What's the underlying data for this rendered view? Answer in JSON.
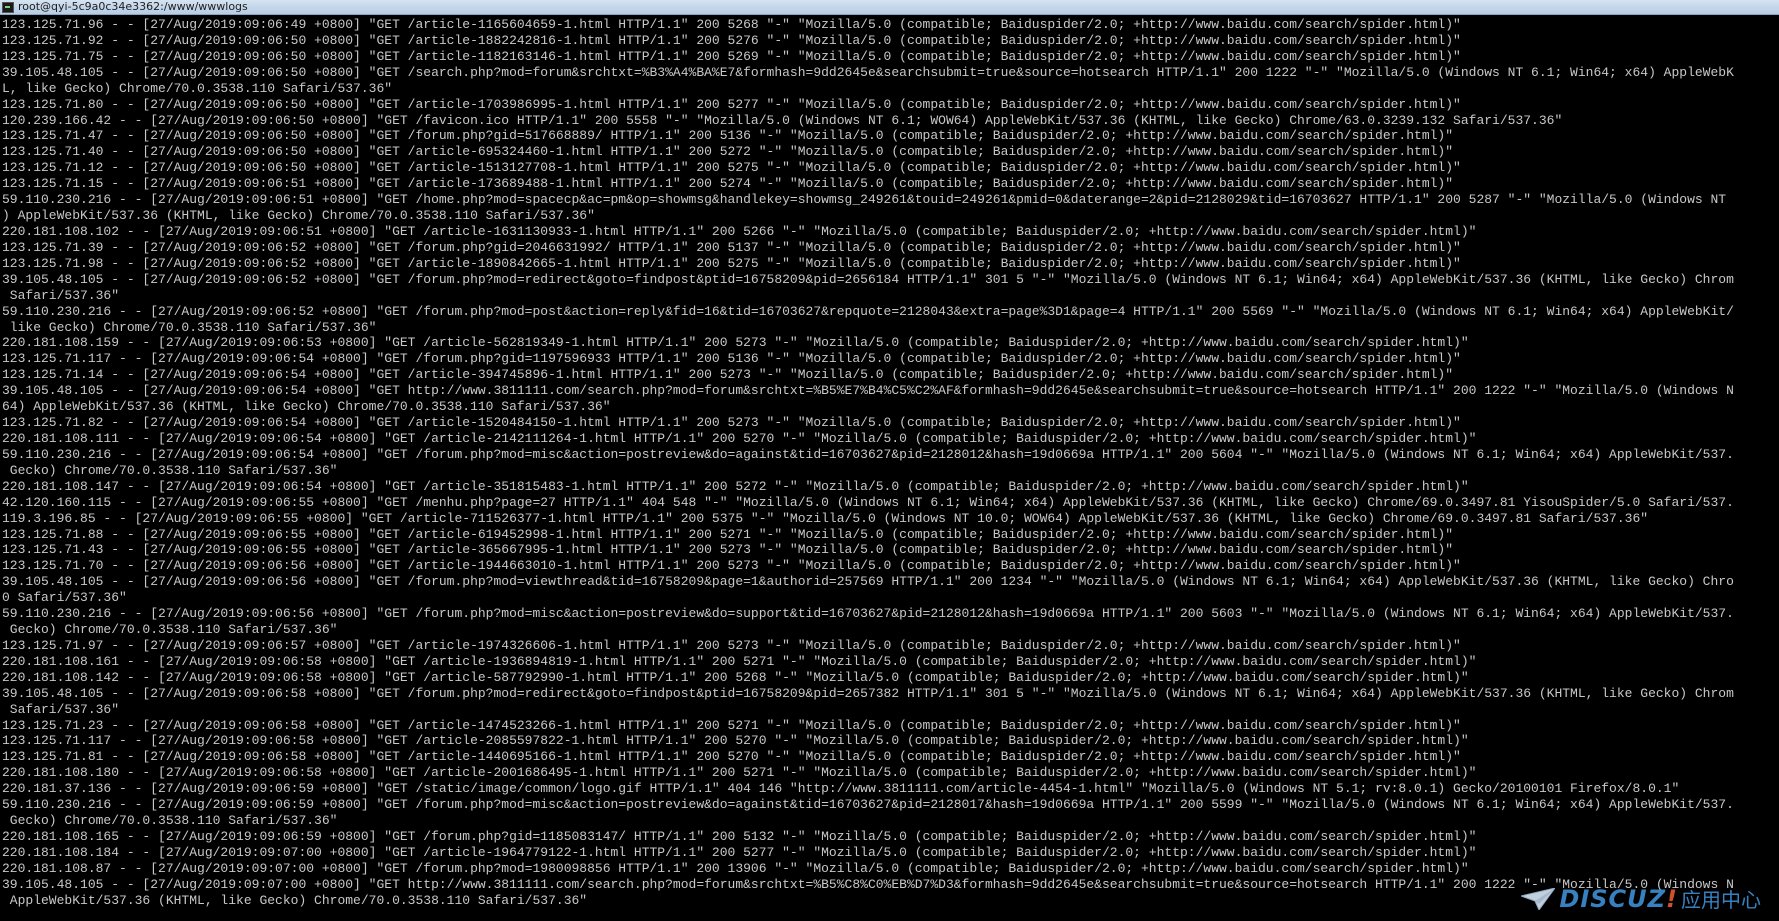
{
  "window": {
    "title": "root@qyi-5c9a0c34e3362:/www/wwwlogs"
  },
  "terminal": {
    "lines": [
      "123.125.71.96 - - [27/Aug/2019:09:06:49 +0800] \"GET /article-1165604659-1.html HTTP/1.1\" 200 5268 \"-\" \"Mozilla/5.0 (compatible; Baiduspider/2.0; +http://www.baidu.com/search/spider.html)\"",
      "123.125.71.92 - - [27/Aug/2019:09:06:50 +0800] \"GET /article-1882242816-1.html HTTP/1.1\" 200 5276 \"-\" \"Mozilla/5.0 (compatible; Baiduspider/2.0; +http://www.baidu.com/search/spider.html)\"",
      "123.125.71.75 - - [27/Aug/2019:09:06:50 +0800] \"GET /article-1182163146-1.html HTTP/1.1\" 200 5269 \"-\" \"Mozilla/5.0 (compatible; Baiduspider/2.0; +http://www.baidu.com/search/spider.html)\"",
      "39.105.48.105 - - [27/Aug/2019:09:06:50 +0800] \"GET /search.php?mod=forum&srchtxt=%B3%A4%BA%E7&formhash=9dd2645e&searchsubmit=true&source=hotsearch HTTP/1.1\" 200 1222 \"-\" \"Mozilla/5.0 (Windows NT 6.1; Win64; x64) AppleWebK",
      "L, like Gecko) Chrome/70.0.3538.110 Safari/537.36\"",
      "123.125.71.80 - - [27/Aug/2019:09:06:50 +0800] \"GET /article-1703986995-1.html HTTP/1.1\" 200 5277 \"-\" \"Mozilla/5.0 (compatible; Baiduspider/2.0; +http://www.baidu.com/search/spider.html)\"",
      "120.239.166.42 - - [27/Aug/2019:09:06:50 +0800] \"GET /favicon.ico HTTP/1.1\" 200 5558 \"-\" \"Mozilla/5.0 (Windows NT 6.1; WOW64) AppleWebKit/537.36 (KHTML, like Gecko) Chrome/63.0.3239.132 Safari/537.36\"",
      "123.125.71.47 - - [27/Aug/2019:09:06:50 +0800] \"GET /forum.php?gid=517668889/ HTTP/1.1\" 200 5136 \"-\" \"Mozilla/5.0 (compatible; Baiduspider/2.0; +http://www.baidu.com/search/spider.html)\"",
      "123.125.71.40 - - [27/Aug/2019:09:06:50 +0800] \"GET /article-695324460-1.html HTTP/1.1\" 200 5272 \"-\" \"Mozilla/5.0 (compatible; Baiduspider/2.0; +http://www.baidu.com/search/spider.html)\"",
      "123.125.71.12 - - [27/Aug/2019:09:06:50 +0800] \"GET /article-1513127708-1.html HTTP/1.1\" 200 5275 \"-\" \"Mozilla/5.0 (compatible; Baiduspider/2.0; +http://www.baidu.com/search/spider.html)\"",
      "123.125.71.15 - - [27/Aug/2019:09:06:51 +0800] \"GET /article-173689488-1.html HTTP/1.1\" 200 5274 \"-\" \"Mozilla/5.0 (compatible; Baiduspider/2.0; +http://www.baidu.com/search/spider.html)\"",
      "59.110.230.216 - - [27/Aug/2019:09:06:51 +0800] \"GET /home.php?mod=spacecp&ac=pm&op=showmsg&handlekey=showmsg_249261&touid=249261&pmid=0&daterange=2&pid=2128029&tid=16703627 HTTP/1.1\" 200 5287 \"-\" \"Mozilla/5.0 (Windows NT",
      ") AppleWebKit/537.36 (KHTML, like Gecko) Chrome/70.0.3538.110 Safari/537.36\"",
      "220.181.108.102 - - [27/Aug/2019:09:06:51 +0800] \"GET /article-1631130933-1.html HTTP/1.1\" 200 5266 \"-\" \"Mozilla/5.0 (compatible; Baiduspider/2.0; +http://www.baidu.com/search/spider.html)\"",
      "123.125.71.39 - - [27/Aug/2019:09:06:52 +0800] \"GET /forum.php?gid=2046631992/ HTTP/1.1\" 200 5137 \"-\" \"Mozilla/5.0 (compatible; Baiduspider/2.0; +http://www.baidu.com/search/spider.html)\"",
      "123.125.71.98 - - [27/Aug/2019:09:06:52 +0800] \"GET /article-1890842665-1.html HTTP/1.1\" 200 5275 \"-\" \"Mozilla/5.0 (compatible; Baiduspider/2.0; +http://www.baidu.com/search/spider.html)\"",
      "39.105.48.105 - - [27/Aug/2019:09:06:52 +0800] \"GET /forum.php?mod=redirect&goto=findpost&ptid=16758209&pid=2656184 HTTP/1.1\" 301 5 \"-\" \"Mozilla/5.0 (Windows NT 6.1; Win64; x64) AppleWebKit/537.36 (KHTML, like Gecko) Chrom",
      " Safari/537.36\"",
      "59.110.230.216 - - [27/Aug/2019:09:06:52 +0800] \"GET /forum.php?mod=post&action=reply&fid=16&tid=16703627&repquote=2128043&extra=page%3D1&page=4 HTTP/1.1\" 200 5569 \"-\" \"Mozilla/5.0 (Windows NT 6.1; Win64; x64) AppleWebKit/",
      " like Gecko) Chrome/70.0.3538.110 Safari/537.36\"",
      "220.181.108.159 - - [27/Aug/2019:09:06:53 +0800] \"GET /article-562819349-1.html HTTP/1.1\" 200 5273 \"-\" \"Mozilla/5.0 (compatible; Baiduspider/2.0; +http://www.baidu.com/search/spider.html)\"",
      "123.125.71.117 - - [27/Aug/2019:09:06:54 +0800] \"GET /forum.php?gid=1197596933 HTTP/1.1\" 200 5136 \"-\" \"Mozilla/5.0 (compatible; Baiduspider/2.0; +http://www.baidu.com/search/spider.html)\"",
      "123.125.71.14 - - [27/Aug/2019:09:06:54 +0800] \"GET /article-394745896-1.html HTTP/1.1\" 200 5273 \"-\" \"Mozilla/5.0 (compatible; Baiduspider/2.0; +http://www.baidu.com/search/spider.html)\"",
      "39.105.48.105 - - [27/Aug/2019:09:06:54 +0800] \"GET http://www.3811111.com/search.php?mod=forum&srchtxt=%B5%E7%B4%C5%C2%AF&formhash=9dd2645e&searchsubmit=true&source=hotsearch HTTP/1.1\" 200 1222 \"-\" \"Mozilla/5.0 (Windows N",
      "64) AppleWebKit/537.36 (KHTML, like Gecko) Chrome/70.0.3538.110 Safari/537.36\"",
      "123.125.71.82 - - [27/Aug/2019:09:06:54 +0800] \"GET /article-1520484150-1.html HTTP/1.1\" 200 5273 \"-\" \"Mozilla/5.0 (compatible; Baiduspider/2.0; +http://www.baidu.com/search/spider.html)\"",
      "220.181.108.111 - - [27/Aug/2019:09:06:54 +0800] \"GET /article-2142111264-1.html HTTP/1.1\" 200 5270 \"-\" \"Mozilla/5.0 (compatible; Baiduspider/2.0; +http://www.baidu.com/search/spider.html)\"",
      "59.110.230.216 - - [27/Aug/2019:09:06:54 +0800] \"GET /forum.php?mod=misc&action=postreview&do=against&tid=16703627&pid=2128012&hash=19d0669a HTTP/1.1\" 200 5604 \"-\" \"Mozilla/5.0 (Windows NT 6.1; Win64; x64) AppleWebKit/537.",
      " Gecko) Chrome/70.0.3538.110 Safari/537.36\"",
      "220.181.108.147 - - [27/Aug/2019:09:06:54 +0800] \"GET /article-351815483-1.html HTTP/1.1\" 200 5272 \"-\" \"Mozilla/5.0 (compatible; Baiduspider/2.0; +http://www.baidu.com/search/spider.html)\"",
      "42.120.160.115 - - [27/Aug/2019:09:06:55 +0800] \"GET /menhu.php?page=27 HTTP/1.1\" 404 548 \"-\" \"Mozilla/5.0 (Windows NT 6.1; Win64; x64) AppleWebKit/537.36 (KHTML, like Gecko) Chrome/69.0.3497.81 YisouSpider/5.0 Safari/537.",
      "119.3.196.85 - - [27/Aug/2019:09:06:55 +0800] \"GET /article-711526377-1.html HTTP/1.1\" 200 5375 \"-\" \"Mozilla/5.0 (Windows NT 10.0; WOW64) AppleWebKit/537.36 (KHTML, like Gecko) Chrome/69.0.3497.81 Safari/537.36\"",
      "123.125.71.88 - - [27/Aug/2019:09:06:55 +0800] \"GET /article-619452998-1.html HTTP/1.1\" 200 5271 \"-\" \"Mozilla/5.0 (compatible; Baiduspider/2.0; +http://www.baidu.com/search/spider.html)\"",
      "123.125.71.43 - - [27/Aug/2019:09:06:55 +0800] \"GET /article-365667995-1.html HTTP/1.1\" 200 5273 \"-\" \"Mozilla/5.0 (compatible; Baiduspider/2.0; +http://www.baidu.com/search/spider.html)\"",
      "123.125.71.70 - - [27/Aug/2019:09:06:56 +0800] \"GET /article-1944663010-1.html HTTP/1.1\" 200 5273 \"-\" \"Mozilla/5.0 (compatible; Baiduspider/2.0; +http://www.baidu.com/search/spider.html)\"",
      "39.105.48.105 - - [27/Aug/2019:09:06:56 +0800] \"GET /forum.php?mod=viewthread&tid=16758209&page=1&authorid=257569 HTTP/1.1\" 200 1234 \"-\" \"Mozilla/5.0 (Windows NT 6.1; Win64; x64) AppleWebKit/537.36 (KHTML, like Gecko) Chro",
      "0 Safari/537.36\"",
      "59.110.230.216 - - [27/Aug/2019:09:06:56 +0800] \"GET /forum.php?mod=misc&action=postreview&do=support&tid=16703627&pid=2128012&hash=19d0669a HTTP/1.1\" 200 5603 \"-\" \"Mozilla/5.0 (Windows NT 6.1; Win64; x64) AppleWebKit/537.",
      " Gecko) Chrome/70.0.3538.110 Safari/537.36\"",
      "123.125.71.97 - - [27/Aug/2019:09:06:57 +0800] \"GET /article-1974326606-1.html HTTP/1.1\" 200 5273 \"-\" \"Mozilla/5.0 (compatible; Baiduspider/2.0; +http://www.baidu.com/search/spider.html)\"",
      "220.181.108.161 - - [27/Aug/2019:09:06:58 +0800] \"GET /article-1936894819-1.html HTTP/1.1\" 200 5271 \"-\" \"Mozilla/5.0 (compatible; Baiduspider/2.0; +http://www.baidu.com/search/spider.html)\"",
      "220.181.108.142 - - [27/Aug/2019:09:06:58 +0800] \"GET /article-587792990-1.html HTTP/1.1\" 200 5268 \"-\" \"Mozilla/5.0 (compatible; Baiduspider/2.0; +http://www.baidu.com/search/spider.html)\"",
      "39.105.48.105 - - [27/Aug/2019:09:06:58 +0800] \"GET /forum.php?mod=redirect&goto=findpost&ptid=16758209&pid=2657382 HTTP/1.1\" 301 5 \"-\" \"Mozilla/5.0 (Windows NT 6.1; Win64; x64) AppleWebKit/537.36 (KHTML, like Gecko) Chrom",
      " Safari/537.36\"",
      "123.125.71.23 - - [27/Aug/2019:09:06:58 +0800] \"GET /article-1474523266-1.html HTTP/1.1\" 200 5271 \"-\" \"Mozilla/5.0 (compatible; Baiduspider/2.0; +http://www.baidu.com/search/spider.html)\"",
      "123.125.71.117 - - [27/Aug/2019:09:06:58 +0800] \"GET /article-2085597822-1.html HTTP/1.1\" 200 5270 \"-\" \"Mozilla/5.0 (compatible; Baiduspider/2.0; +http://www.baidu.com/search/spider.html)\"",
      "123.125.71.81 - - [27/Aug/2019:09:06:58 +0800] \"GET /article-1440695166-1.html HTTP/1.1\" 200 5270 \"-\" \"Mozilla/5.0 (compatible; Baiduspider/2.0; +http://www.baidu.com/search/spider.html)\"",
      "220.181.108.180 - - [27/Aug/2019:09:06:58 +0800] \"GET /article-2001686495-1.html HTTP/1.1\" 200 5271 \"-\" \"Mozilla/5.0 (compatible; Baiduspider/2.0; +http://www.baidu.com/search/spider.html)\"",
      "220.181.37.136 - - [27/Aug/2019:09:06:59 +0800] \"GET /static/image/common/logo.gif HTTP/1.1\" 404 146 \"http://www.3811111.com/article-4454-1.html\" \"Mozilla/5.0 (Windows NT 5.1; rv:8.0.1) Gecko/20100101 Firefox/8.0.1\"",
      "59.110.230.216 - - [27/Aug/2019:09:06:59 +0800] \"GET /forum.php?mod=misc&action=postreview&do=against&tid=16703627&pid=2128017&hash=19d0669a HTTP/1.1\" 200 5599 \"-\" \"Mozilla/5.0 (Windows NT 6.1; Win64; x64) AppleWebKit/537.",
      " Gecko) Chrome/70.0.3538.110 Safari/537.36\"",
      "220.181.108.165 - - [27/Aug/2019:09:06:59 +0800] \"GET /forum.php?gid=1185083147/ HTTP/1.1\" 200 5132 \"-\" \"Mozilla/5.0 (compatible; Baiduspider/2.0; +http://www.baidu.com/search/spider.html)\"",
      "220.181.108.184 - - [27/Aug/2019:09:07:00 +0800] \"GET /article-1964779122-1.html HTTP/1.1\" 200 5277 \"-\" \"Mozilla/5.0 (compatible; Baiduspider/2.0; +http://www.baidu.com/search/spider.html)\"",
      "220.181.108.87 - - [27/Aug/2019:09:07:00 +0800] \"GET /forum.php?mod=1980098856 HTTP/1.1\" 200 13906 \"-\" \"Mozilla/5.0 (compatible; Baiduspider/2.0; +http://www.baidu.com/search/spider.html)\"",
      "39.105.48.105 - - [27/Aug/2019:09:07:00 +0800] \"GET http://www.3811111.com/search.php?mod=forum&srchtxt=%B5%C8%C0%EB%D7%D3&formhash=9dd2645e&searchsubmit=true&source=hotsearch HTTP/1.1\" 200 1222 \"-\" \"Mozilla/5.0 (Windows N",
      " AppleWebKit/537.36 (KHTML, like Gecko) Chrome/70.0.3538.110 Safari/537.36\""
    ]
  },
  "watermark": {
    "brand": "DISCUZ",
    "mark": "!",
    "sub": "应用中心"
  }
}
